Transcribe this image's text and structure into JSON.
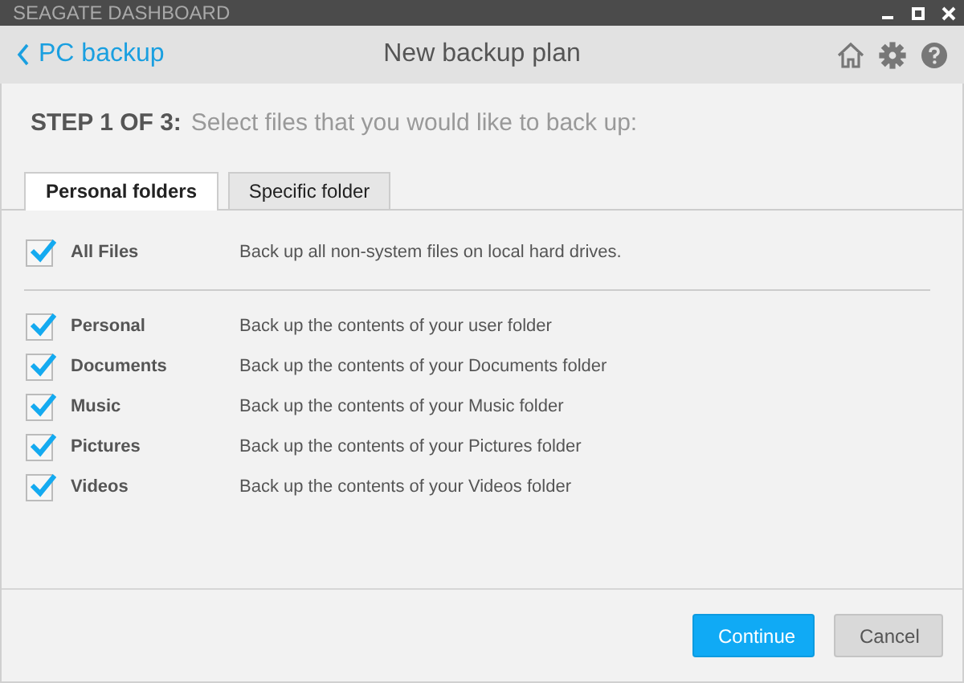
{
  "window": {
    "title": "SEAGATE DASHBOARD"
  },
  "header": {
    "back": "PC backup",
    "title": "New backup plan"
  },
  "step": {
    "label": "STEP 1 OF 3:",
    "text": "Select files that you would like to back up:"
  },
  "tabs": [
    {
      "label": "Personal folders",
      "selected": true
    },
    {
      "label": "Specific folder",
      "selected": false
    }
  ],
  "all_files": {
    "name": "All Files",
    "description": "Back up all non-system files on local hard drives.",
    "checked": true
  },
  "folders": [
    {
      "name": "Personal",
      "description": "Back up the contents of your user folder",
      "checked": true
    },
    {
      "name": "Documents",
      "description": "Back up the contents of your Documents folder",
      "checked": true
    },
    {
      "name": "Music",
      "description": "Back up the contents of your Music folder",
      "checked": true
    },
    {
      "name": "Pictures",
      "description": "Back up the contents of your Pictures folder",
      "checked": true
    },
    {
      "name": "Videos",
      "description": "Back up the contents of your Videos folder",
      "checked": true
    }
  ],
  "buttons": [
    {
      "label": "Continue",
      "kind": "primary"
    },
    {
      "label": "Cancel",
      "kind": "secondary"
    }
  ]
}
